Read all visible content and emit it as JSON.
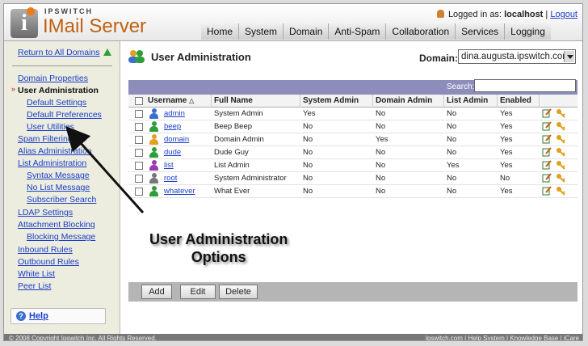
{
  "app": {
    "brand_top": "IPSWITCH",
    "brand_main": "IMail Server"
  },
  "session": {
    "logged_prefix": "Logged in as:",
    "user": "localhost",
    "separator": "|",
    "logout": "Logout"
  },
  "nav": {
    "tabs": [
      "Home",
      "System",
      "Domain",
      "Anti-Spam",
      "Collaboration",
      "Services",
      "Logging"
    ]
  },
  "sidebar": {
    "return_link": "Return to All Domains",
    "items": [
      {
        "label": "Domain Properties",
        "sub": false,
        "active": false
      },
      {
        "label": "User Administration",
        "sub": false,
        "active": true
      },
      {
        "label": "Default Settings",
        "sub": true,
        "active": false
      },
      {
        "label": "Default Preferences",
        "sub": true,
        "active": false
      },
      {
        "label": "User Utilities",
        "sub": true,
        "active": false
      },
      {
        "label": "Spam Filtering",
        "sub": false,
        "active": false
      },
      {
        "label": "Alias Administration",
        "sub": false,
        "active": false
      },
      {
        "label": "List Administration",
        "sub": false,
        "active": false
      },
      {
        "label": "Syntax Message",
        "sub": true,
        "active": false
      },
      {
        "label": "No List Message",
        "sub": true,
        "active": false
      },
      {
        "label": "Subscriber Search",
        "sub": true,
        "active": false
      },
      {
        "label": "LDAP Settings",
        "sub": false,
        "active": false
      },
      {
        "label": "Attachment Blocking",
        "sub": false,
        "active": false
      },
      {
        "label": "Blocking Message",
        "sub": true,
        "active": false
      },
      {
        "label": "Inbound Rules",
        "sub": false,
        "active": false
      },
      {
        "label": "Outbound Rules",
        "sub": false,
        "active": false
      },
      {
        "label": "White List",
        "sub": false,
        "active": false
      },
      {
        "label": "Peer List",
        "sub": false,
        "active": false
      }
    ],
    "help": "Help"
  },
  "main": {
    "title": "User Administration",
    "domain_label": "Domain:",
    "domain_value": "dina.augusta.ipswitch.com",
    "search_label": "Search:",
    "search_value": "",
    "columns": [
      "Username",
      "Full Name",
      "System Admin",
      "Domain Admin",
      "List Admin",
      "Enabled"
    ],
    "rows": [
      {
        "username": "admin",
        "full_name": "System Admin",
        "system_admin": "Yes",
        "domain_admin": "No",
        "list_admin": "No",
        "enabled": "Yes",
        "icon_color": "#3a6fd0"
      },
      {
        "username": "beep",
        "full_name": "Beep Beep",
        "system_admin": "No",
        "domain_admin": "No",
        "list_admin": "No",
        "enabled": "Yes",
        "icon_color": "#2e9e3a"
      },
      {
        "username": "domain",
        "full_name": "Domain Admin",
        "system_admin": "No",
        "domain_admin": "Yes",
        "list_admin": "No",
        "enabled": "Yes",
        "icon_color": "#e0a020"
      },
      {
        "username": "dude",
        "full_name": "Dude Guy",
        "system_admin": "No",
        "domain_admin": "No",
        "list_admin": "No",
        "enabled": "Yes",
        "icon_color": "#2e9e3a"
      },
      {
        "username": "list",
        "full_name": "List Admin",
        "system_admin": "No",
        "domain_admin": "No",
        "list_admin": "Yes",
        "enabled": "Yes",
        "icon_color": "#9a3ab0"
      },
      {
        "username": "root",
        "full_name": "System Administrator",
        "system_admin": "No",
        "domain_admin": "No",
        "list_admin": "No",
        "enabled": "No",
        "icon_color": "#777777"
      },
      {
        "username": "whatever",
        "full_name": "What Ever",
        "system_admin": "No",
        "domain_admin": "No",
        "list_admin": "No",
        "enabled": "Yes",
        "icon_color": "#2e9e3a"
      }
    ],
    "buttons": [
      "Add",
      "Edit",
      "Delete"
    ]
  },
  "footer": {
    "left": "© 2008 Copyright Ipswitch Inc. All Rights Reserved.",
    "right": "Ipswitch.com | Help System | Knowledge Base | iCare"
  },
  "annotation": {
    "line1": "User Administration",
    "line2": "Options"
  },
  "colors": {
    "accent": "#c06010",
    "link": "#1a3ec8",
    "grid_header": "#8d8dbb",
    "sidebar_bg": "#ececdf"
  }
}
